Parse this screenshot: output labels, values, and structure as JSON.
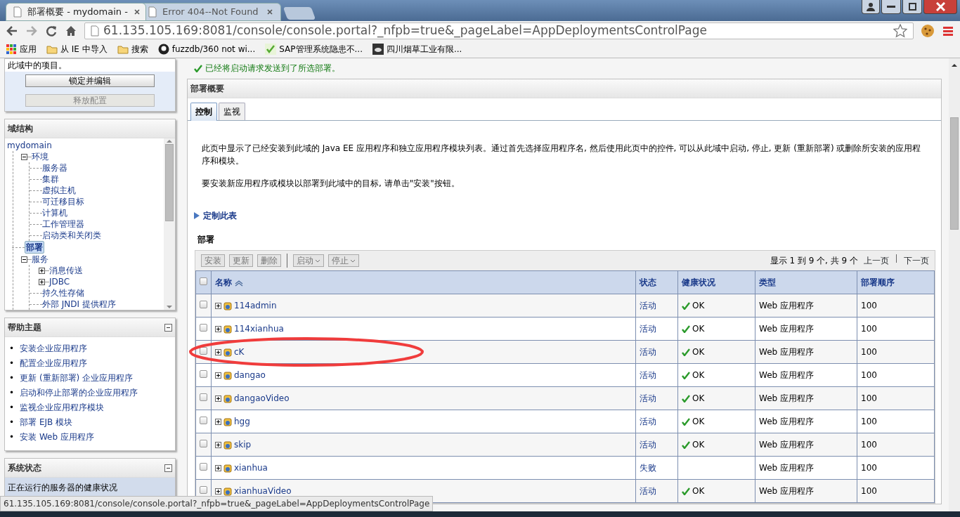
{
  "browser": {
    "tabs": [
      {
        "title": "部署概要 - mydomain -",
        "selected": true
      },
      {
        "title": "Error 404--Not Found",
        "selected": false
      }
    ],
    "address": "61.135.105.169:8081/console/console.portal?_nfpb=true&_pageLabel=AppDeploymentsControlPage",
    "bookmarks": [
      {
        "label": "应用",
        "kind": "apps"
      },
      {
        "label": "从 IE 中导入",
        "kind": "folder"
      },
      {
        "label": "搜索",
        "kind": "folder"
      },
      {
        "label": "fuzzdb/360 not wi...",
        "kind": "github"
      },
      {
        "label": "SAP管理系统隐患不...",
        "kind": "sap"
      },
      {
        "label": "四川烟草工业有限...",
        "kind": "cloud"
      }
    ],
    "status_url": "61.135.105.169:8081/console/console.portal?_nfpb=true&_pageLabel=AppDeploymentsControlPage"
  },
  "sidebar": {
    "change_center": {
      "text": "此域中的项目。",
      "buttons": [
        {
          "label": "锁定并编辑",
          "disabled": false
        },
        {
          "label": "释放配置",
          "disabled": true
        }
      ]
    },
    "domain_structure": {
      "title": "域结构",
      "tree": [
        {
          "label": "mydomain",
          "selected": false,
          "children": [
            {
              "label": "环境",
              "selected": false,
              "expanded": true,
              "children": [
                {
                  "label": "服务器",
                  "selected": false
                },
                {
                  "label": "集群",
                  "selected": false
                },
                {
                  "label": "虚拟主机",
                  "selected": false
                },
                {
                  "label": "可迁移目标",
                  "selected": false
                },
                {
                  "label": "计算机",
                  "selected": false
                },
                {
                  "label": "工作管理器",
                  "selected": false
                },
                {
                  "label": "启动类和关闭类",
                  "selected": false
                }
              ]
            },
            {
              "label": "部署",
              "selected": true
            },
            {
              "label": "服务",
              "selected": false,
              "expanded": true,
              "children": [
                {
                  "label": "消息传送",
                  "selected": false,
                  "expanded": false
                },
                {
                  "label": "JDBC",
                  "selected": false,
                  "expanded": false
                },
                {
                  "label": "持久性存储",
                  "selected": false
                },
                {
                  "label": "外部 JNDI 提供程序",
                  "selected": false
                }
              ]
            }
          ]
        }
      ]
    },
    "help": {
      "title": "帮助主题",
      "links": [
        {
          "marker": "•",
          "label": "安装企业应用程序"
        },
        {
          "marker": "•",
          "label": "配置企业应用程序"
        },
        {
          "marker": "•",
          "label": "更新 (重新部署) 企业应用程序"
        },
        {
          "marker": "•",
          "label": "启动和停止部署的企业应用程序"
        },
        {
          "marker": "•",
          "label": "监视企业应用程序模块"
        },
        {
          "marker": "•",
          "label": "部署 EJB 模块"
        },
        {
          "marker": "•",
          "label": "安装 Web 应用程序"
        }
      ]
    },
    "system_status": {
      "title": "系统状态",
      "row": "正在运行的服务器的健康状况"
    }
  },
  "main": {
    "message": "已经将启动请求发送到了所选部署。",
    "panel_title": "部署概要",
    "tabs": [
      {
        "label": "控制",
        "selected": true
      },
      {
        "label": "监视",
        "selected": false
      }
    ],
    "paragraphs": [
      "此页中显示了已经安装到此域的 Java EE 应用程序和独立应用程序模块列表。通过首先选择应用程序名, 然后使用此页中的控件, 可以从此域中启动, 停止, 更新 (重新部署) 或删除所安装的应用程序和模块。",
      "要安装新应用程序或模块以部署到此域中的目标, 请单击\"安装\"按钮。"
    ],
    "customize_link": "定制此表",
    "table_title": "部署",
    "toolbar": [
      {
        "label": "安装",
        "kind": "button"
      },
      {
        "label": "更新",
        "kind": "button"
      },
      {
        "label": "删除",
        "kind": "button"
      },
      {
        "label": "启动",
        "kind": "menu"
      },
      {
        "label": "停止",
        "kind": "menu"
      }
    ],
    "pager": {
      "info": "显示 1 到 9 个, 共 9 个",
      "prev": "上一页",
      "next": "下一页"
    },
    "select_all_checked": false,
    "columns": [
      "名称",
      "状态",
      "健康状况",
      "类型",
      "部署顺序"
    ],
    "rows": [
      {
        "name": "114admin",
        "state": "活动",
        "health": "OK",
        "type": "Web 应用程序",
        "order": "100",
        "checked": false
      },
      {
        "name": "114xianhua",
        "state": "活动",
        "health": "OK",
        "type": "Web 应用程序",
        "order": "100",
        "checked": false
      },
      {
        "name": "cK",
        "state": "活动",
        "health": "OK",
        "type": "Web 应用程序",
        "order": "100",
        "checked": false
      },
      {
        "name": "dangao",
        "state": "活动",
        "health": "OK",
        "type": "Web 应用程序",
        "order": "100",
        "checked": false
      },
      {
        "name": "dangaoVideo",
        "state": "活动",
        "health": "OK",
        "type": "Web 应用程序",
        "order": "100",
        "checked": false
      },
      {
        "name": "hgg",
        "state": "活动",
        "health": "OK",
        "type": "Web 应用程序",
        "order": "100",
        "checked": false
      },
      {
        "name": "skip",
        "state": "活动",
        "health": "OK",
        "type": "Web 应用程序",
        "order": "100",
        "checked": false
      },
      {
        "name": "xianhua",
        "state": "失败",
        "type": "Web 应用程序",
        "order": "100",
        "checked": false
      },
      {
        "name": "xianhuaVideo",
        "state": "活动",
        "health": "OK",
        "type": "Web 应用程序",
        "order": "100",
        "checked": false
      }
    ]
  }
}
